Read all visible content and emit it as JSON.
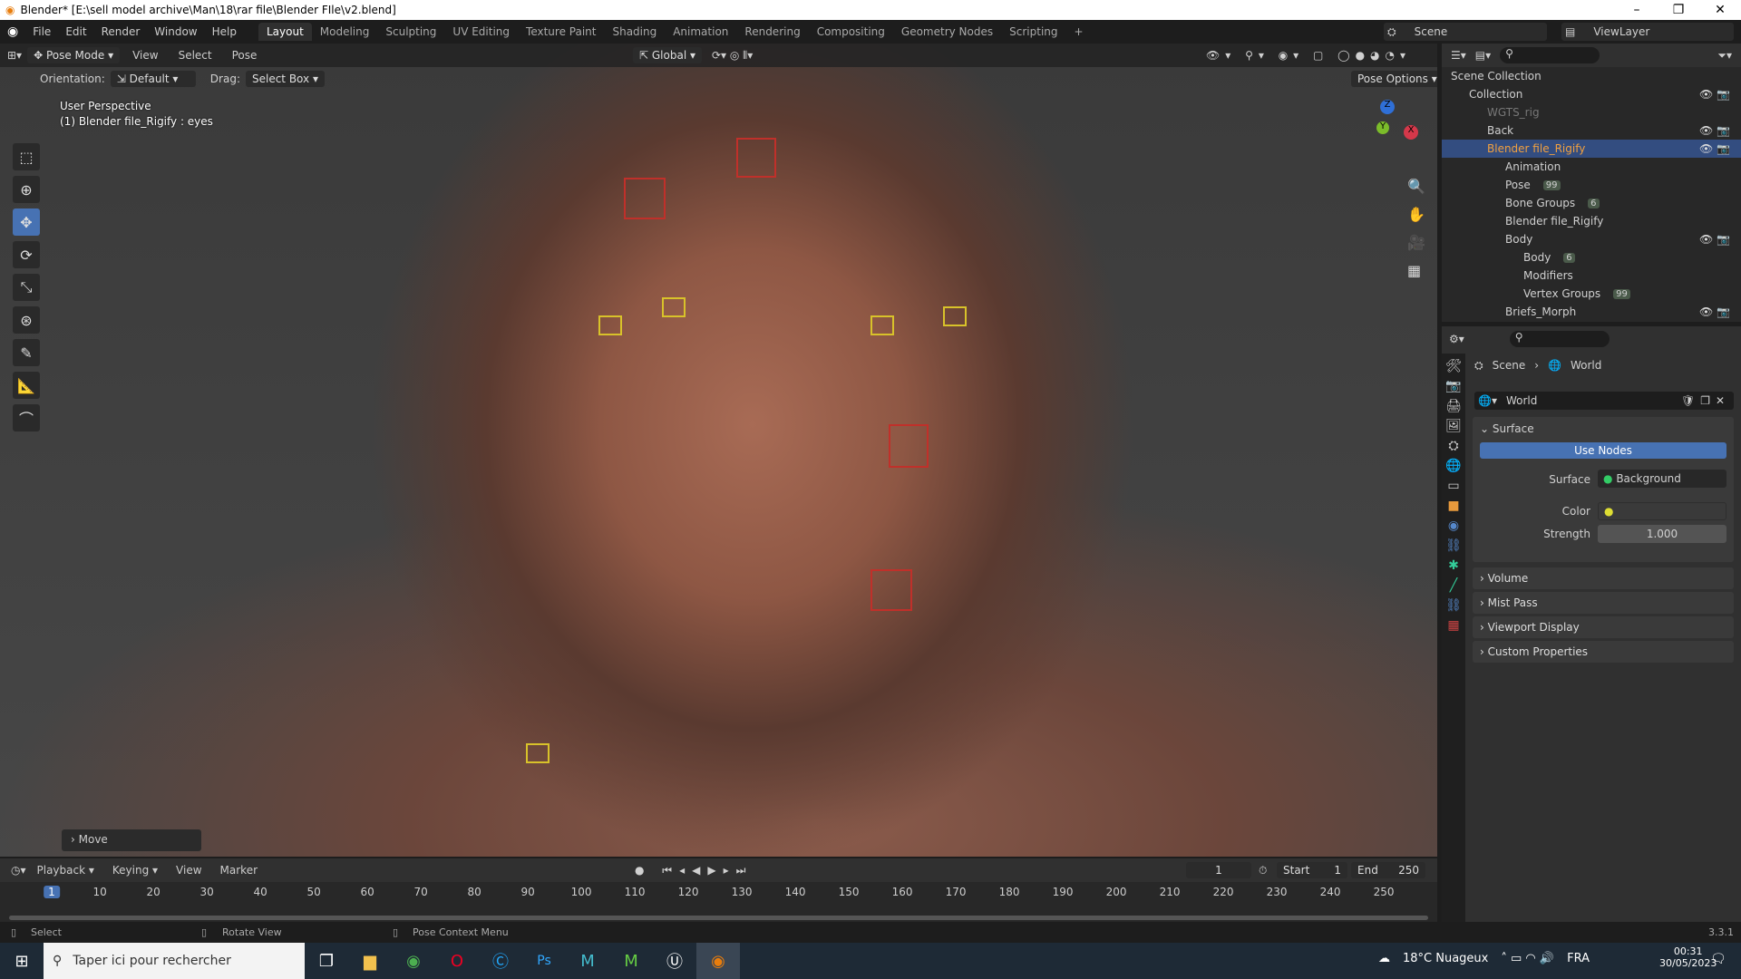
{
  "window": {
    "title": "Blender* [E:\\sell model archive\\Man\\18\\rar file\\Blender FIle\\v2.blend]",
    "minimize": "–",
    "maximize": "❐",
    "close": "✕"
  },
  "menu": [
    "File",
    "Edit",
    "Render",
    "Window",
    "Help"
  ],
  "workspaces": [
    "Layout",
    "Modeling",
    "Sculpting",
    "UV Editing",
    "Texture Paint",
    "Shading",
    "Animation",
    "Rendering",
    "Compositing",
    "Geometry Nodes",
    "Scripting",
    "+"
  ],
  "scene": {
    "scene_label": "Scene",
    "viewlayer_label": "ViewLayer"
  },
  "viewport": {
    "mode": "Pose Mode",
    "menus": [
      "View",
      "Select",
      "Pose"
    ],
    "transform_orientation": "Global",
    "orientation_label": "Orientation:",
    "orientation_value": "Default",
    "drag_label": "Drag:",
    "drag_value": "Select Box",
    "pose_options": "Pose Options",
    "view_name": "User Perspective",
    "active_object": "(1) Blender file_Rigify : eyes",
    "last_op": "Move",
    "gizmo": {
      "x": "X",
      "y": "Y",
      "z": "Z"
    }
  },
  "outliner": {
    "rows": [
      {
        "label": "Scene Collection",
        "indent": 0
      },
      {
        "label": "Collection",
        "indent": 1
      },
      {
        "label": "WGTS_rig",
        "indent": 2
      },
      {
        "label": "Back",
        "indent": 2
      },
      {
        "label": "Blender file_Rigify",
        "indent": 2,
        "selected": true
      },
      {
        "label": "Animation",
        "indent": 3
      },
      {
        "label": "Pose",
        "indent": 3,
        "badge": "99"
      },
      {
        "label": "Bone Groups",
        "indent": 3,
        "badge": "6"
      },
      {
        "label": "Blender file_Rigify",
        "indent": 3
      },
      {
        "label": "Body",
        "indent": 3
      },
      {
        "label": "Body",
        "indent": 4,
        "badge": "6"
      },
      {
        "label": "Modifiers",
        "indent": 4
      },
      {
        "label": "Vertex Groups",
        "indent": 4,
        "badge": "99"
      },
      {
        "label": "Briefs_Morph",
        "indent": 3
      }
    ]
  },
  "properties": {
    "breadcrumb": [
      "Scene",
      "World"
    ],
    "datablock": "World",
    "surface_panel": "Surface",
    "use_nodes": "Use Nodes",
    "surface_label": "Surface",
    "surface_value": "Background",
    "color_label": "Color",
    "strength_label": "Strength",
    "strength_value": "1.000",
    "panels": [
      "Volume",
      "Mist Pass",
      "Viewport Display",
      "Custom Properties"
    ]
  },
  "timeline": {
    "menus": [
      "Playback",
      "Keying",
      "View",
      "Marker"
    ],
    "current_frame": "1",
    "start_label": "Start",
    "start": "1",
    "end_label": "End",
    "end": "250",
    "ticks": [
      "1",
      "10",
      "20",
      "30",
      "40",
      "50",
      "60",
      "70",
      "80",
      "90",
      "100",
      "110",
      "120",
      "130",
      "140",
      "150",
      "160",
      "170",
      "180",
      "190",
      "200",
      "210",
      "220",
      "230",
      "240",
      "250"
    ]
  },
  "status": {
    "select": "Select",
    "rotate": "Rotate View",
    "context": "Pose Context Menu",
    "version": "3.3.1"
  },
  "taskbar": {
    "search_placeholder": "Taper ici pour rechercher",
    "weather": "18°C Nuageux",
    "lang": "FRA",
    "time": "00:31",
    "date": "30/05/2023"
  }
}
